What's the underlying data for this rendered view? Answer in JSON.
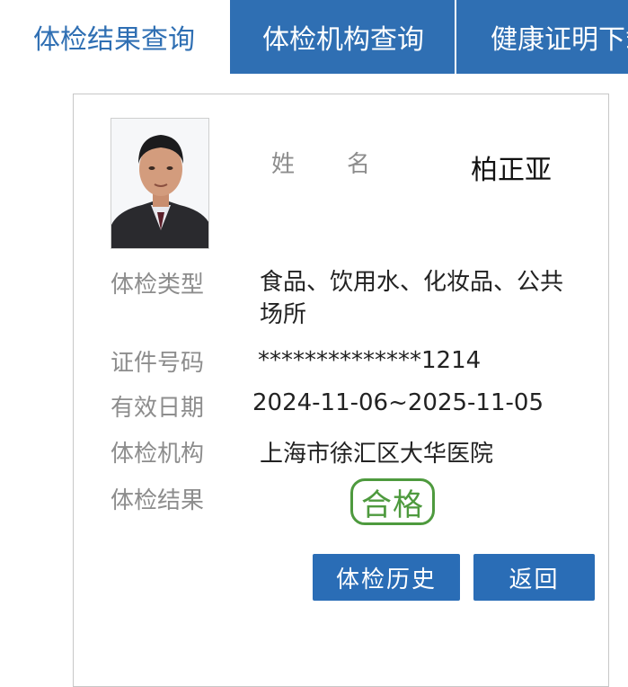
{
  "tabs": [
    {
      "label": "体检结果查询",
      "active": true
    },
    {
      "label": "体检机构查询",
      "active": false
    },
    {
      "label": "健康证明下载",
      "active": false
    }
  ],
  "record": {
    "name_label": "姓　　名",
    "name_value": "柏正亚",
    "exam_type_label": "体检类型",
    "exam_type_value": "食品、饮用水、化妆品、公共场所",
    "id_label": "证件号码",
    "id_value": "**************1214",
    "validity_label": "有效日期",
    "validity_value": "2024-11-06~2025-11-05",
    "institution_label": "体检机构",
    "institution_value": "上海市徐汇区大华医院",
    "result_label": "体检结果",
    "result_value": "合格"
  },
  "buttons": {
    "history": "体检历史",
    "back": "返回"
  },
  "colors": {
    "tab_blue": "#2f6fb3",
    "button_blue": "#2a6db6",
    "stamp_green": "#4e9a3e",
    "label_gray": "#8d8d8d"
  }
}
